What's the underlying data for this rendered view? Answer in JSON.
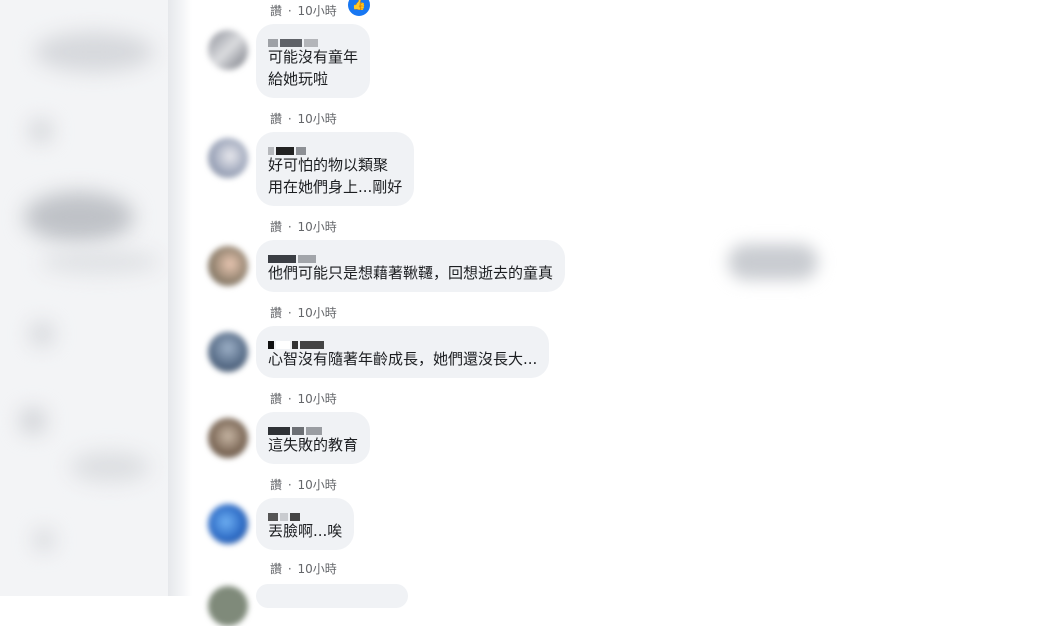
{
  "comments": [
    {
      "meta": {
        "action": "讚",
        "sep": "·",
        "time": "10小時"
      }
    },
    {
      "lines": [
        "可能沒有童年",
        "給她玩啦"
      ],
      "meta": {
        "action": "讚",
        "sep": "·",
        "time": "10小時"
      }
    },
    {
      "lines": [
        "好可怕的物以類聚",
        "用在她們身上...剛好"
      ],
      "meta": {
        "action": "讚",
        "sep": "·",
        "time": "10小時"
      }
    },
    {
      "lines": [
        "他們可能只是想藉著鞦韆，回想逝去的童真"
      ],
      "meta": {
        "action": "讚",
        "sep": "·",
        "time": "10小時"
      }
    },
    {
      "lines": [
        "心智沒有隨著年齡成長，她們還沒長大..."
      ],
      "meta": {
        "action": "讚",
        "sep": "·",
        "time": "10小時"
      }
    },
    {
      "lines": [
        "這失敗的教育"
      ],
      "meta": {
        "action": "讚",
        "sep": "·",
        "time": "10小時"
      }
    },
    {
      "lines": [
        "丟臉啊...唉"
      ],
      "meta": {
        "action": "讚",
        "sep": "·",
        "time": "10小時"
      }
    }
  ],
  "colors": {
    "bubble": "#f0f2f5",
    "meta_text": "#65676b",
    "reaction": "#1877f2"
  }
}
